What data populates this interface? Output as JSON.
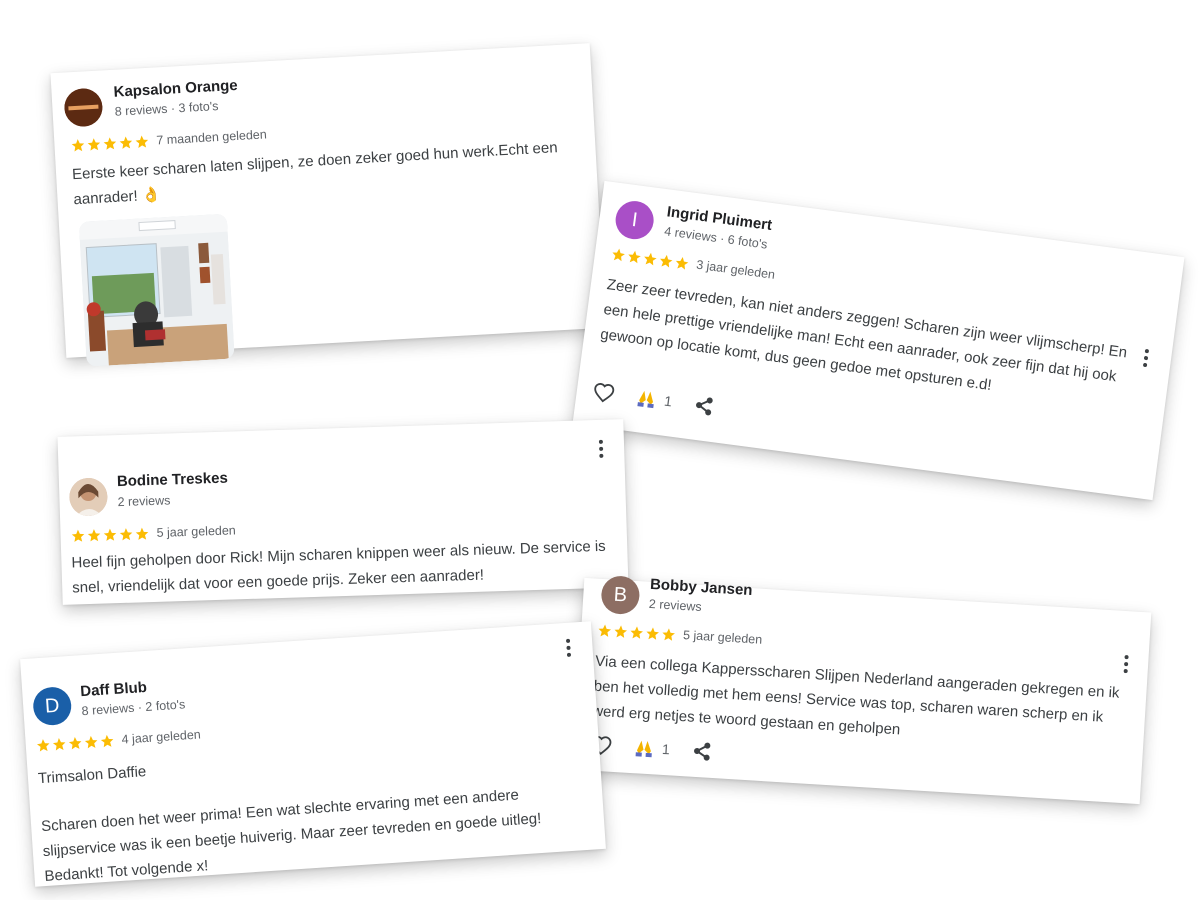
{
  "reviews": [
    {
      "name": "Kapsalon Orange",
      "meta": "8 reviews · 3 foto's",
      "rating": 5,
      "time": "7 maanden geleden",
      "text": "Eerste keer scharen laten slijpen, ze doen zeker goed hun werk.Echt een aanrader! 👌",
      "avatar_letter": "",
      "avatar_color": "#7a3b1e"
    },
    {
      "name": "Ingrid Pluimert",
      "meta": "4 reviews · 6 foto's",
      "rating": 5,
      "time": "3 jaar geleden",
      "text": "Zeer zeer tevreden, kan niet anders zeggen! Scharen zijn weer vlijmscherp! En een hele prettige vriendelijke man! Echt een aanrader, ook zeer fijn dat hij ook gewoon op locatie komt, dus geen gedoe met opsturen e.d!",
      "avatar_letter": "I",
      "avatar_color": "#a94fc7",
      "reaction_count": "1"
    },
    {
      "name": "Bodine Treskes",
      "meta": "2 reviews",
      "rating": 5,
      "time": "5 jaar geleden",
      "text": "Heel fijn geholpen door Rick! Mijn scharen knippen weer als nieuw. De service is snel, vriendelijk dat voor een goede prijs. Zeker een aanrader!",
      "avatar_letter": "",
      "avatar_color": "#b98a6b"
    },
    {
      "name": "Bobby Jansen",
      "meta": "2 reviews",
      "rating": 5,
      "time": "5 jaar geleden",
      "text": "Via een collega Kappersscharen Slijpen Nederland aangeraden gekregen en ik ben het volledig met hem eens! Service was top, scharen waren scherp en ik werd erg netjes te woord gestaan en geholpen",
      "avatar_letter": "B",
      "avatar_color": "#8d6e63",
      "reaction_count": "1"
    },
    {
      "name": "Daff Blub",
      "meta": "8 reviews · 2 foto's",
      "rating": 5,
      "time": "4 jaar geleden",
      "text_line1": "Trimsalon Daffie",
      "text": "Scharen doen het weer prima! Een wat slechte ervaring met een andere slijpservice was ik een beetje huiverig. Maar zeer tevreden en goede uitleg! Bedankt! Tot volgende x!",
      "avatar_letter": "D",
      "avatar_color": "#1a5fa8"
    }
  ],
  "colors": {
    "star": "#fbbc04",
    "text": "#3c4043",
    "muted": "#5f6368"
  },
  "icons": {
    "like": "heart-outline-icon",
    "reaction": "pray-hands-icon",
    "share": "share-icon",
    "menu": "more-vert-icon"
  }
}
